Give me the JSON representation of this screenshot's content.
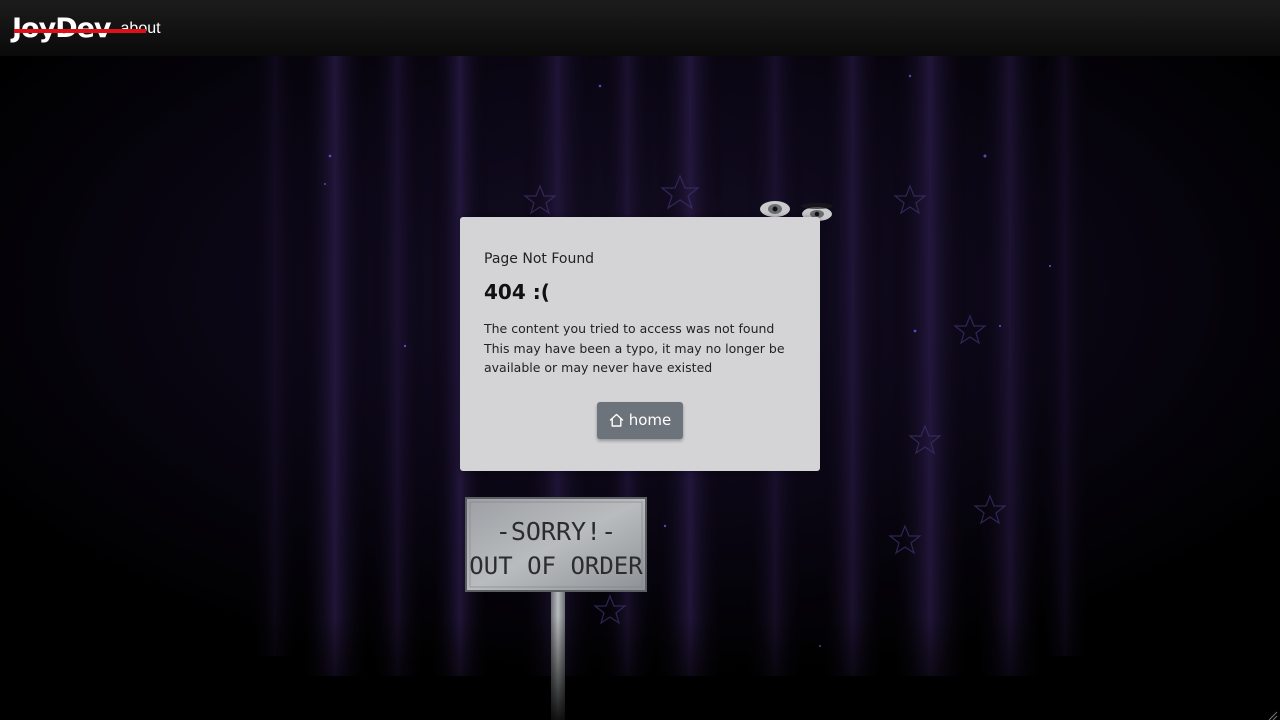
{
  "navbar": {
    "logo_text": "JoyDev",
    "about_label": "about"
  },
  "card": {
    "subtitle": "Page Not Found",
    "title": "404 :(",
    "body_lines": [
      "The content you tried to access was not found",
      "This may have been a typo, it may no longer be",
      "available or may never have existed"
    ],
    "home_label": "home"
  },
  "sign": {
    "line1": "-SORRY!-",
    "line2": "OUT OF ORDER"
  },
  "icons": {
    "home": "home-icon",
    "grip": "resize-grip-icon"
  },
  "colors": {
    "accent_red": "#e01018",
    "card_bg": "#d4d4d6",
    "button_bg": "#6c737b",
    "curtain": "#1a1030"
  }
}
